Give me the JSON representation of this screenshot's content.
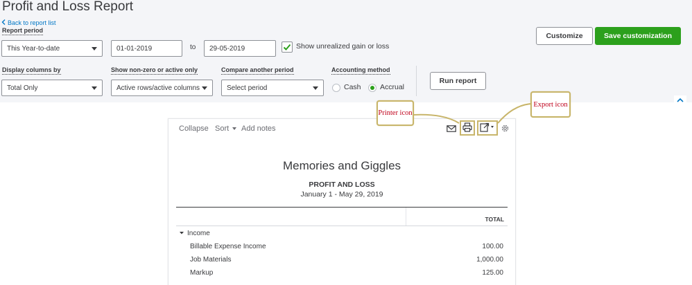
{
  "page": {
    "title": "Profit and Loss Report",
    "back_link": "Back to report list"
  },
  "filters": {
    "report_period_label": "Report period",
    "report_period_value": "This Year-to-date",
    "from_date": "01-01-2019",
    "to_label": "to",
    "to_date": "29-05-2019",
    "unrealized_label": "Show unrealized gain or loss",
    "unrealized_checked": true,
    "display_columns_label": "Display columns by",
    "display_columns_value": "Total Only",
    "non_zero_label": "Show non-zero or active only",
    "non_zero_value": "Active rows/active columns",
    "compare_label": "Compare another period",
    "compare_placeholder": "Select period",
    "accounting_label": "Accounting method",
    "cash_label": "Cash",
    "accrual_label": "Accrual",
    "selected_method": "Accrual"
  },
  "buttons": {
    "customize": "Customize",
    "save_customization": "Save customization",
    "run_report": "Run report"
  },
  "toolbar": {
    "collapse": "Collapse",
    "sort": "Sort",
    "add_notes": "Add notes"
  },
  "report": {
    "company": "Memories and Giggles",
    "title": "PROFIT AND LOSS",
    "dates": "January 1 - May 29, 2019",
    "column_header": "TOTAL",
    "section": "Income",
    "rows": [
      {
        "name": "Billable Expense Income",
        "amount": "100.00"
      },
      {
        "name": "Job Materials",
        "amount": "1,000.00"
      },
      {
        "name": "Markup",
        "amount": "125.00"
      }
    ]
  },
  "annotations": {
    "printer": "Printer icon",
    "export": "Export icon"
  },
  "colors": {
    "accent_green": "#2ca01c",
    "link_blue": "#0077c5",
    "annotation_border": "#c8b56a",
    "annotation_text": "#c0001a"
  }
}
